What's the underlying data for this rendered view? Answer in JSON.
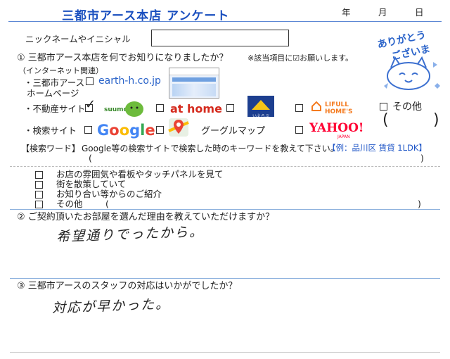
{
  "header": {
    "title": "三都市アース本店 アンケート",
    "year": "年",
    "month": "月",
    "day": "日"
  },
  "nickname": {
    "label": "ニックネームやイニシャル",
    "value": ""
  },
  "q1": {
    "question": "① 三都市アース本店を何でお知りになりましたか？",
    "note": "※該当項目に☑お願いします。",
    "internet_label": "（インターネット関連）",
    "homepage_label_1": "・三都市アース",
    "homepage_label_2": "ホームページ",
    "homepage_url": "earth-h.co.jp",
    "homepage_checked": false,
    "realestate_label": "・不動産サイト",
    "realestate": {
      "suumo": {
        "text": "suumo",
        "checked": true
      },
      "athome": {
        "text": "at home",
        "checked": false
      },
      "ieichiba": {
        "text": "いえらぶ",
        "checked": false
      },
      "homes": {
        "text": "LIFULL HOME'S",
        "checked": false
      },
      "other": {
        "text": "その他",
        "checked": false
      }
    },
    "search_label": "・検索サイト",
    "search": {
      "google": {
        "text": "Google",
        "checked": false
      },
      "maps": {
        "text": "グーグルマップ",
        "checked": false
      },
      "yahoo": {
        "text": "YAHOO!",
        "yahoo_sub": "JAPAN",
        "checked": false
      }
    },
    "keyword_label": "【検索ワード】",
    "keyword_desc": "Google等の検索サイトで検索した時のキーワードを教えて下さい。",
    "keyword_example": "【例：品川区 賃貸 1LDK】",
    "keyword_value": "",
    "options": [
      {
        "text": "お店の雰囲気や看板やタッチパネルを見て",
        "checked": false
      },
      {
        "text": "街を散策していて",
        "checked": false
      },
      {
        "text": "お知り合い等からのご紹介",
        "checked": false
      },
      {
        "text": "その他",
        "checked": false
      }
    ]
  },
  "q2": {
    "question": "② ご契約頂いたお部屋を選んだ理由を教えていただけますか？",
    "answer": "希望通りでったから。"
  },
  "q3": {
    "question": "③ 三都市アースのスタッフの対応はいかがでしたか？",
    "answer": "対応が早かった。"
  },
  "sticker": {
    "text_1": "ありがとう",
    "text_2": "ございます。"
  },
  "colors": {
    "accent": "#1f56c7",
    "title": "#1a4fbf",
    "google_blue": "#4285F4",
    "google_red": "#EA4335",
    "google_yellow": "#FBBC05",
    "google_green": "#34A853",
    "athome_red": "#d52b1e",
    "yahoo_red": "#ff0033",
    "homes_orange": "#f47b20"
  }
}
